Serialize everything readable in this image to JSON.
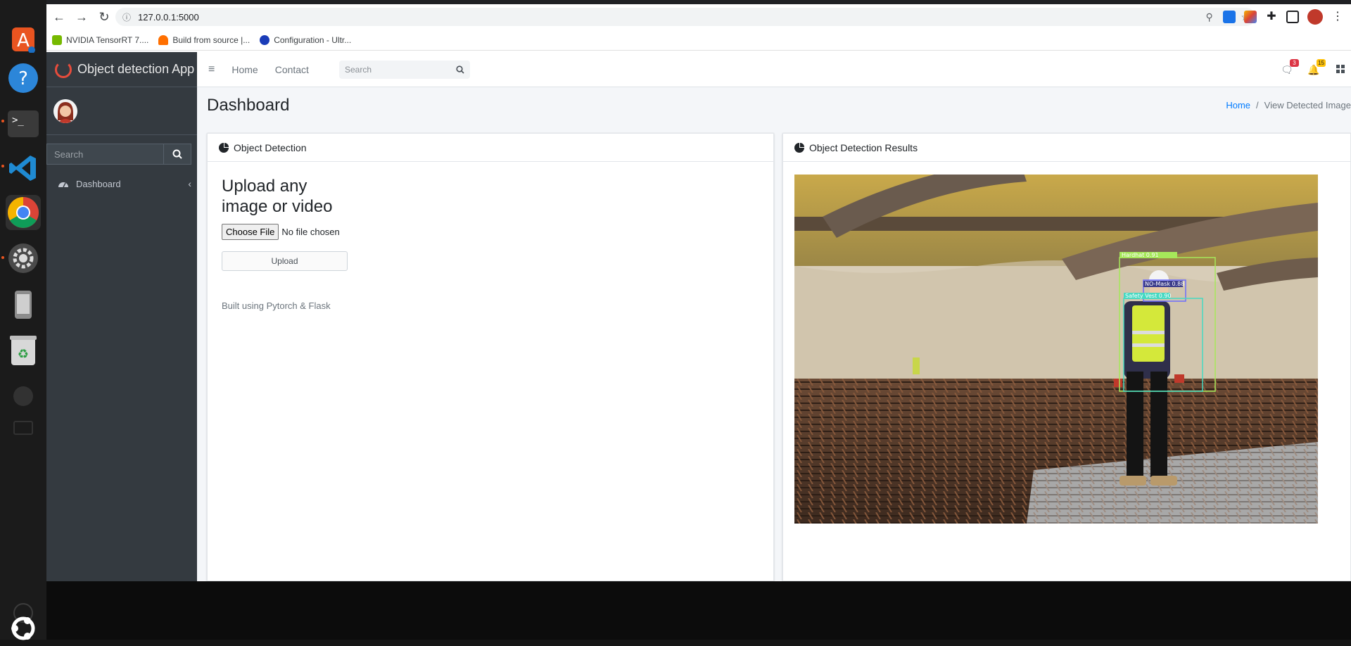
{
  "browser": {
    "url": "127.0.0.1:5000",
    "bookmarks": [
      {
        "label": "NVIDIA TensorRT 7...."
      },
      {
        "label": "Build from source  |..."
      },
      {
        "label": "Configuration - Ultr..."
      }
    ]
  },
  "app": {
    "brand": "Object detection App",
    "sidebar_search_placeholder": "Search",
    "nav": [
      {
        "label": "Dashboard",
        "icon": "tachometer-icon"
      }
    ],
    "header_links": [
      "Home",
      "Contact"
    ],
    "header_search_placeholder": "Search",
    "badges": {
      "messages": "3",
      "notifications": "15"
    },
    "page_title": "Dashboard",
    "breadcrumb": {
      "home": "Home",
      "separator": "/",
      "current": "View Detected Image"
    },
    "left_card": {
      "title": "Object Detection",
      "upload_title": "Upload any image or video",
      "choose_file": "Choose File",
      "no_file": "No file chosen",
      "upload_button": "Upload",
      "note": "Built using Pytorch & Flask"
    },
    "right_card": {
      "title": "Object Detection Results",
      "detections": [
        {
          "label": "Hardhat",
          "score": "0.91"
        },
        {
          "label": "NO-Mask",
          "score": "0.88"
        },
        {
          "label": "Safety Vest",
          "score": "0.90"
        }
      ]
    }
  },
  "colors": {
    "sidebar_bg": "#343a40",
    "accent_link": "#007bff",
    "badge_messages": "#dc3545",
    "badge_notifications": "#ffc107"
  }
}
